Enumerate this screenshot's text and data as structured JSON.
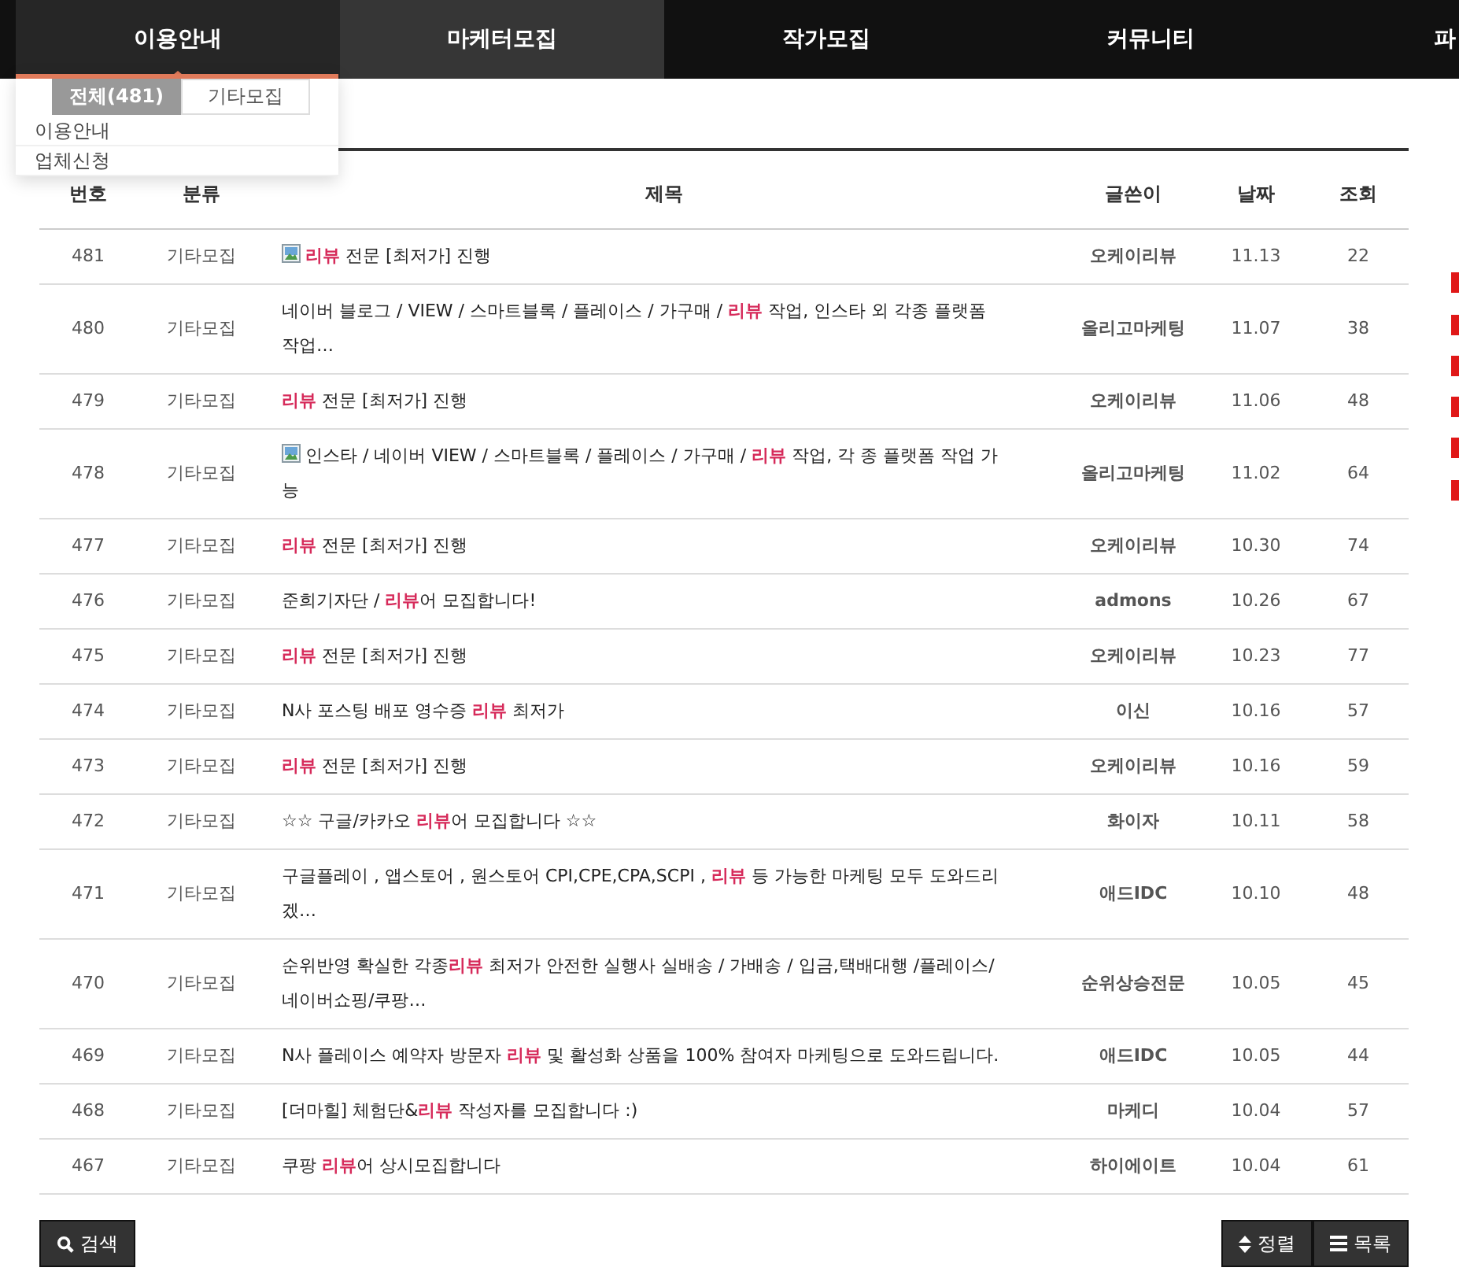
{
  "nav": {
    "items": [
      {
        "label": "이용안내",
        "selected": false,
        "expanded": true
      },
      {
        "label": "마케터모집",
        "selected": true,
        "expanded": false
      },
      {
        "label": "작가모집",
        "selected": false,
        "expanded": false
      },
      {
        "label": "커뮤니티",
        "selected": false,
        "expanded": false
      },
      {
        "label": "파",
        "selected": false,
        "expanded": false
      }
    ]
  },
  "dropdown": {
    "items": [
      "이용안내",
      "업체신청"
    ]
  },
  "category_tabs": [
    {
      "label": "전체(481)",
      "selected": true
    },
    {
      "label": "기타모집",
      "selected": false
    }
  ],
  "table": {
    "columns": [
      "번호",
      "분류",
      "제목",
      "글쓴이",
      "날짜",
      "조회"
    ],
    "rows": [
      {
        "no": "481",
        "category": "기타모집",
        "has_image": true,
        "title": "**리뷰** 전문 [최저가] 진행",
        "author": "오케이리뷰",
        "date": "11.13",
        "views": "22"
      },
      {
        "no": "480",
        "category": "기타모집",
        "has_image": false,
        "title": "네이버 블로그 / VIEW / 스마트블록 / 플레이스 / 가구매 / **리뷰** 작업, 인스타 외 각종 플랫폼 작업…",
        "author": "올리고마케팅",
        "date": "11.07",
        "views": "38"
      },
      {
        "no": "479",
        "category": "기타모집",
        "has_image": false,
        "title": "**리뷰** 전문 [최저가] 진행",
        "author": "오케이리뷰",
        "date": "11.06",
        "views": "48"
      },
      {
        "no": "478",
        "category": "기타모집",
        "has_image": true,
        "title": "인스타 / 네이버 VIEW / 스마트블록 / 플레이스 / 가구매 / **리뷰** 작업, 각 종 플랫폼 작업 가능",
        "author": "올리고마케팅",
        "date": "11.02",
        "views": "64"
      },
      {
        "no": "477",
        "category": "기타모집",
        "has_image": false,
        "title": "**리뷰** 전문 [최저가] 진행",
        "author": "오케이리뷰",
        "date": "10.30",
        "views": "74"
      },
      {
        "no": "476",
        "category": "기타모집",
        "has_image": false,
        "title": "준희기자단 / **리뷰**어 모집합니다!",
        "author": "admons",
        "date": "10.26",
        "views": "67"
      },
      {
        "no": "475",
        "category": "기타모집",
        "has_image": false,
        "title": "**리뷰** 전문 [최저가] 진행",
        "author": "오케이리뷰",
        "date": "10.23",
        "views": "77"
      },
      {
        "no": "474",
        "category": "기타모집",
        "has_image": false,
        "title": "N사 포스팅 배포 영수증 **리뷰** 최저가",
        "author": "이신",
        "date": "10.16",
        "views": "57"
      },
      {
        "no": "473",
        "category": "기타모집",
        "has_image": false,
        "title": "**리뷰** 전문 [최저가] 진행",
        "author": "오케이리뷰",
        "date": "10.16",
        "views": "59"
      },
      {
        "no": "472",
        "category": "기타모집",
        "has_image": false,
        "title": "☆☆ 구글/카카오 **리뷰**어 모집합니다 ☆☆",
        "author": "화이자",
        "date": "10.11",
        "views": "58"
      },
      {
        "no": "471",
        "category": "기타모집",
        "has_image": false,
        "title": "구글플레이 , 앱스토어 , 원스토어 CPI,CPE,CPA,SCPI , **리뷰** 등 가능한 마케팅 모두 도와드리겠…",
        "author": "애드IDC",
        "date": "10.10",
        "views": "48"
      },
      {
        "no": "470",
        "category": "기타모집",
        "has_image": false,
        "title": "순위반영 확실한 각종**리뷰** 최저가 안전한 실행사 실배송 / 가배송 / 입금,택배대행 /플레이스/네이버쇼핑/쿠팡…",
        "author": "순위상승전문",
        "date": "10.05",
        "views": "45"
      },
      {
        "no": "469",
        "category": "기타모집",
        "has_image": false,
        "title": "N사 플레이스 예약자 방문자 **리뷰** 및 활성화 상품을 100% 참여자 마케팅으로 도와드립니다.",
        "author": "애드IDC",
        "date": "10.05",
        "views": "44"
      },
      {
        "no": "468",
        "category": "기타모집",
        "has_image": false,
        "title": "[더마힐] 체험단&**리뷰** 작성자를 모집합니다 :)",
        "author": "마케디",
        "date": "10.04",
        "views": "57"
      },
      {
        "no": "467",
        "category": "기타모집",
        "has_image": false,
        "title": "쿠팡 **리뷰**어 상시모집합니다",
        "author": "하이에이트",
        "date": "10.04",
        "views": "61"
      }
    ]
  },
  "buttons": {
    "search": "검색",
    "sort": "정렬",
    "list": "목록"
  }
}
